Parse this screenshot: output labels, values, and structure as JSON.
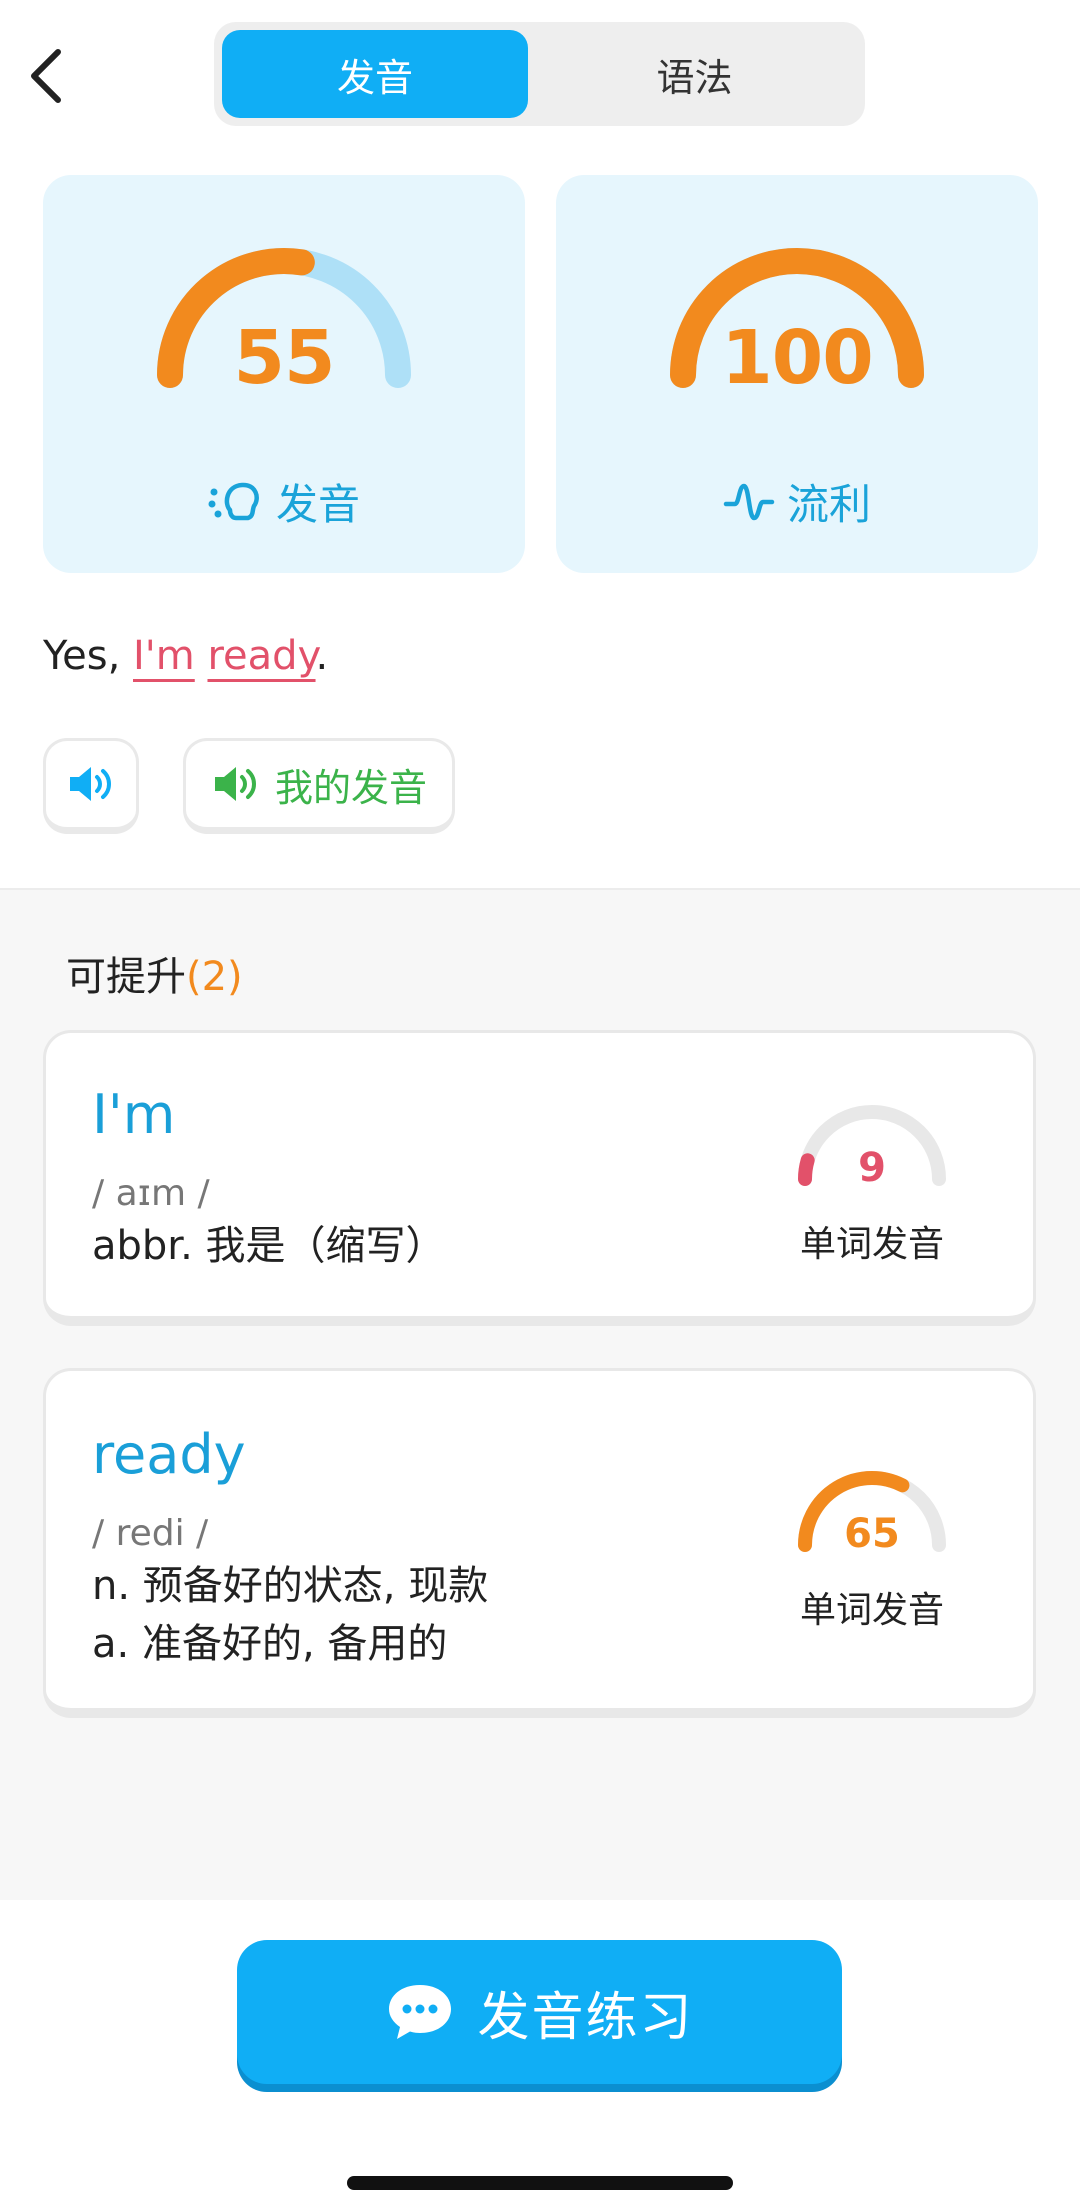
{
  "header": {
    "tabs": [
      {
        "label": "发音",
        "active": true
      },
      {
        "label": "语法",
        "active": false
      }
    ]
  },
  "scores": [
    {
      "value": "55",
      "label": "发音",
      "fraction": 0.55
    },
    {
      "value": "100",
      "label": "流利",
      "fraction": 1.0
    }
  ],
  "sentence": {
    "prefix": "Yes, ",
    "word1": "I'm",
    "space": " ",
    "word2": "ready",
    "suffix": "."
  },
  "audio": {
    "mine_label": "我的发音"
  },
  "improve": {
    "title": "可提升",
    "count": "(2)"
  },
  "words": [
    {
      "word": "I'm",
      "phonetic": "/ aɪm /",
      "definitions": [
        "abbr. 我是（缩写）"
      ],
      "score": "9",
      "score_fraction": 0.09,
      "score_label": "单词发音"
    },
    {
      "word": "ready",
      "phonetic": "/ redi /",
      "definitions": [
        "n. 预备好的状态, 现款",
        "a. 准备好的, 备用的"
      ],
      "score": "65",
      "score_fraction": 0.65,
      "score_label": "单词发音"
    }
  ],
  "cta": {
    "label": "发音练习"
  },
  "colors": {
    "accent": "#10aef5",
    "score_orange": "#f28a1e",
    "gauge_track": "#aee0f7",
    "bad_red": "#e2516a",
    "good_green": "#3bb34a",
    "card_bg": "#e6f6fd"
  }
}
